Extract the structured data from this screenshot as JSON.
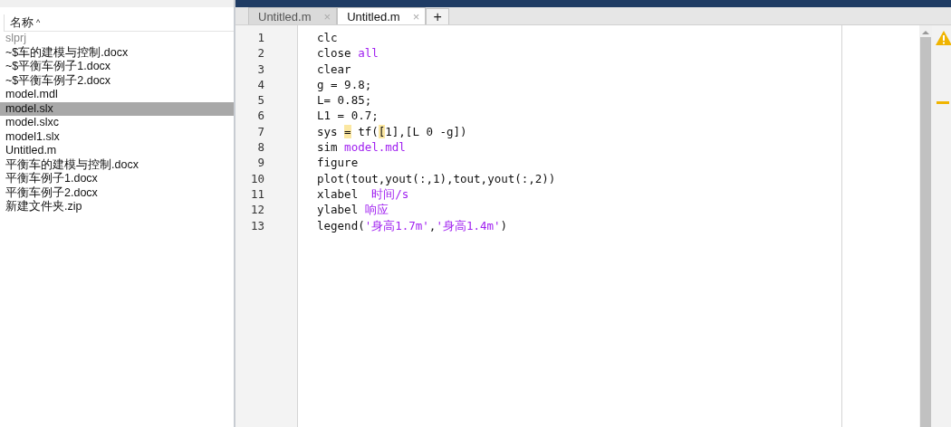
{
  "file_browser": {
    "column": "名称",
    "sort": "^",
    "items": [
      {
        "name": "slprj",
        "kind": "folder",
        "selected": false
      },
      {
        "name": "~$车的建模与控制.docx",
        "kind": "file",
        "selected": false
      },
      {
        "name": "~$平衡车例子1.docx",
        "kind": "file",
        "selected": false
      },
      {
        "name": "~$平衡车例子2.docx",
        "kind": "file",
        "selected": false
      },
      {
        "name": "model.mdl",
        "kind": "file",
        "selected": false
      },
      {
        "name": "model.slx",
        "kind": "file",
        "selected": true
      },
      {
        "name": "model.slxc",
        "kind": "file",
        "selected": false
      },
      {
        "name": "model1.slx",
        "kind": "file",
        "selected": false
      },
      {
        "name": "Untitled.m",
        "kind": "file",
        "selected": false
      },
      {
        "name": "平衡车的建模与控制.docx",
        "kind": "file",
        "selected": false
      },
      {
        "name": "平衡车例子1.docx",
        "kind": "file",
        "selected": false
      },
      {
        "name": "平衡车例子2.docx",
        "kind": "file",
        "selected": false
      },
      {
        "name": "新建文件夹.zip",
        "kind": "file",
        "selected": false
      }
    ]
  },
  "tabs": [
    {
      "label": "Untitled.m",
      "close": "×",
      "selected": false
    },
    {
      "label": "Untitled.m",
      "close": "×",
      "selected": true
    }
  ],
  "new_tab": "+",
  "editor": {
    "lines": [
      {
        "no": "1",
        "segments": [
          {
            "t": "clc",
            "kind": "plain"
          }
        ]
      },
      {
        "no": "2",
        "segments": [
          {
            "t": "close ",
            "kind": "plain"
          },
          {
            "t": "all",
            "kind": "string"
          }
        ]
      },
      {
        "no": "3",
        "segments": [
          {
            "t": "clear",
            "kind": "plain"
          }
        ]
      },
      {
        "no": "4",
        "segments": [
          {
            "t": "g = 9.8;",
            "kind": "plain"
          }
        ]
      },
      {
        "no": "5",
        "segments": [
          {
            "t": "L= 0.85;",
            "kind": "plain"
          }
        ]
      },
      {
        "no": "6",
        "segments": [
          {
            "t": "L1 = 0.7;",
            "kind": "plain"
          }
        ]
      },
      {
        "no": "7",
        "segments": [
          {
            "t": "sys ",
            "kind": "plain"
          },
          {
            "t": "=",
            "kind": "highlight"
          },
          {
            "t": " tf(",
            "kind": "plain"
          },
          {
            "t": "[",
            "kind": "highlight"
          },
          {
            "t": "1],[L 0 -g])",
            "kind": "plain"
          }
        ]
      },
      {
        "no": "8",
        "segments": [
          {
            "t": "sim ",
            "kind": "plain"
          },
          {
            "t": "model.mdl",
            "kind": "string"
          }
        ]
      },
      {
        "no": "9",
        "segments": [
          {
            "t": "figure",
            "kind": "plain"
          }
        ]
      },
      {
        "no": "10",
        "segments": [
          {
            "t": "plot(tout,yout(:,1),tout,yout(:,2))",
            "kind": "plain"
          }
        ]
      },
      {
        "no": "11",
        "segments": [
          {
            "t": "xlabel  ",
            "kind": "plain"
          },
          {
            "t": "时间/s",
            "kind": "string"
          }
        ]
      },
      {
        "no": "12",
        "segments": [
          {
            "t": "ylabel ",
            "kind": "plain"
          },
          {
            "t": "响应",
            "kind": "string"
          }
        ]
      },
      {
        "no": "13",
        "segments": [
          {
            "t": "legend(",
            "kind": "plain"
          },
          {
            "t": "'身高1.7m'",
            "kind": "string"
          },
          {
            "t": ",",
            "kind": "plain"
          },
          {
            "t": "'身高1.4m'",
            "kind": "string"
          },
          {
            "t": ")",
            "kind": "plain"
          }
        ]
      }
    ]
  }
}
